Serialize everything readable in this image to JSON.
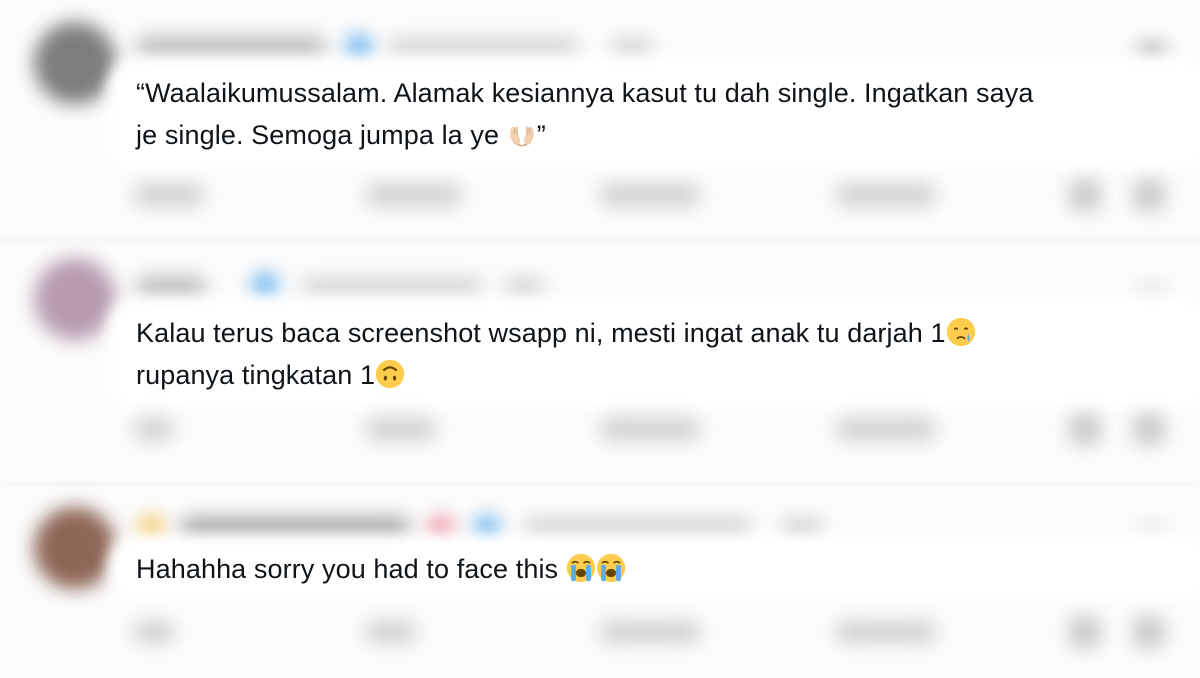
{
  "replies": [
    {
      "line1": "“Waalaikumussalam. Alamak kesiannya kasut tu dah single. Ingatkan saya",
      "line2_text": "je single. Semoga jumpa la ye ",
      "line2_after": "”",
      "emojis": [
        "palms-up-together-emoji"
      ]
    },
    {
      "line1_text": "Kalau terus baca screenshot wsapp ni, mesti ingat anak tu darjah 1",
      "line2_text": "rupanya tingkatan 1",
      "emojis": [
        "face-holding-back-tears-emoji",
        "upside-down-face-emoji"
      ]
    },
    {
      "line1_text": "Hahahha sorry you had to face this ",
      "emojis": [
        "loudly-crying-face-emoji",
        "loudly-crying-face-emoji"
      ]
    }
  ],
  "colors": {
    "text": "#0f1419",
    "verified": "#6fb6ef",
    "background": "#ffffff"
  }
}
